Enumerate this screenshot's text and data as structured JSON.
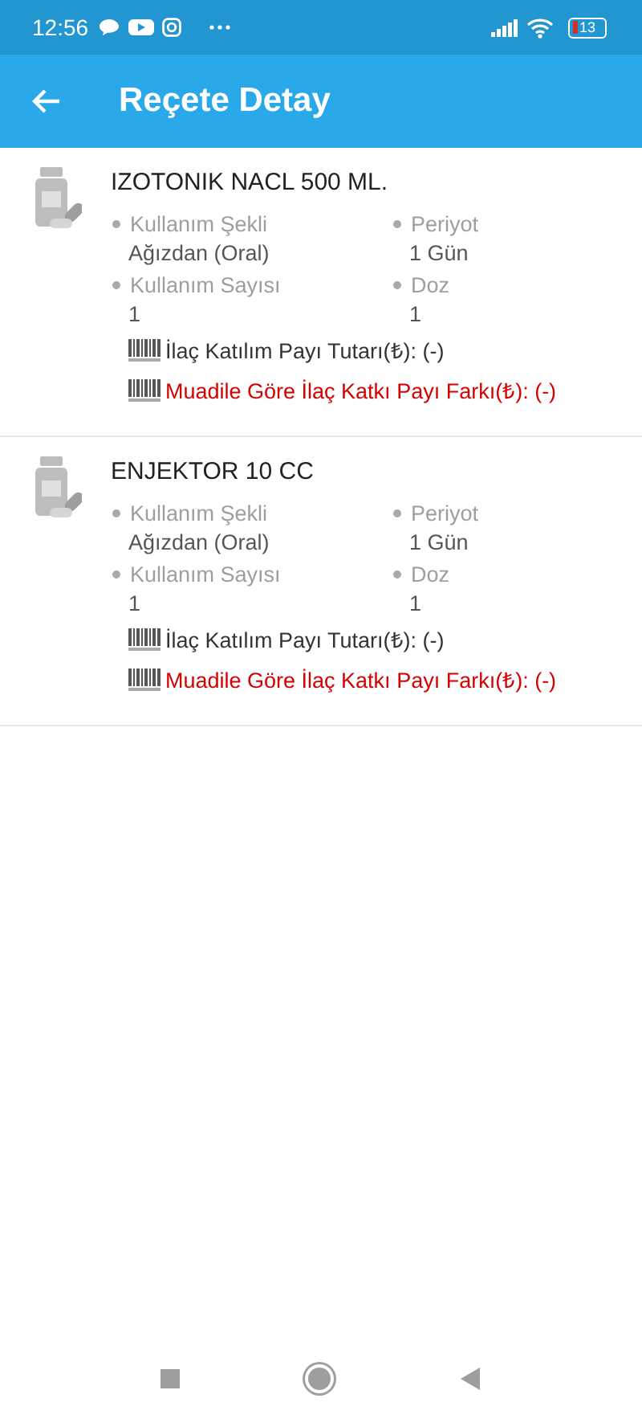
{
  "status_bar": {
    "time": "12:56",
    "battery": "13"
  },
  "app_bar": {
    "title": "Reçete Detay"
  },
  "items": [
    {
      "name": "IZOTONIK NACL 500 ML.",
      "fields": [
        {
          "label": "Kullanım Şekli",
          "value": "Ağızdan (Oral)"
        },
        {
          "label": "Periyot",
          "value": "1 Gün"
        },
        {
          "label": "Kullanım Sayısı",
          "value": "1"
        },
        {
          "label": "Doz",
          "value": "1"
        }
      ],
      "lines": [
        {
          "kind": "normal",
          "text": "İlaç Katılım Payı Tutarı(₺): (-)"
        },
        {
          "kind": "warning",
          "text": "Muadile Göre İlaç Katkı Payı Farkı(₺): (-)"
        }
      ]
    },
    {
      "name": "ENJEKTOR 10 CC",
      "fields": [
        {
          "label": "Kullanım Şekli",
          "value": "Ağızdan (Oral)"
        },
        {
          "label": "Periyot",
          "value": "1 Gün"
        },
        {
          "label": "Kullanım Sayısı",
          "value": "1"
        },
        {
          "label": "Doz",
          "value": "1"
        }
      ],
      "lines": [
        {
          "kind": "normal",
          "text": "İlaç Katılım Payı Tutarı(₺): (-)"
        },
        {
          "kind": "warning",
          "text": "Muadile Göre İlaç Katkı Payı Farkı(₺): (-)"
        }
      ]
    }
  ]
}
